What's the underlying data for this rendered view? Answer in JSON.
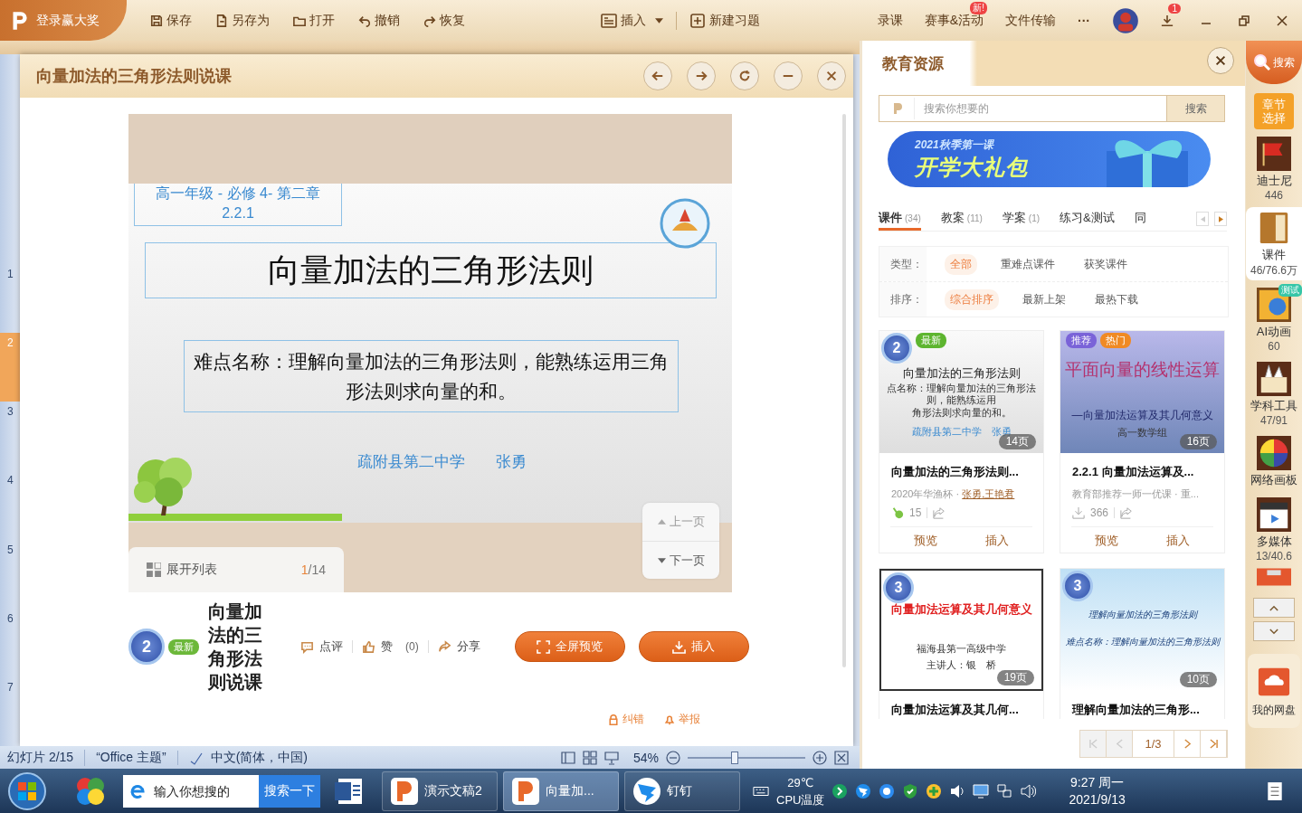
{
  "app_bar": {
    "login": "登录赢大奖",
    "tools": [
      {
        "label": "保存"
      },
      {
        "label": "另存为"
      },
      {
        "label": "打开"
      },
      {
        "label": "撤销"
      },
      {
        "label": "恢复"
      }
    ],
    "insert": "插入",
    "new_exercise": "新建习题",
    "links": [
      {
        "label": "录课"
      },
      {
        "label": "赛事&活动",
        "badge": "新!"
      },
      {
        "label": "文件传输"
      }
    ],
    "more": "···",
    "download_badge": "1"
  },
  "slide_panel": [
    {
      "number": "1",
      "selected": false
    },
    {
      "number": "2",
      "selected": true
    },
    {
      "number": "3",
      "selected": false
    },
    {
      "number": "4",
      "selected": false
    },
    {
      "number": "5",
      "selected": false
    },
    {
      "number": "6",
      "selected": false
    },
    {
      "number": "7",
      "selected": false
    }
  ],
  "dialog": {
    "title": "向量加法的三角形法则说课",
    "slide": {
      "grade": "高一年级 - 必修 4- 第二章",
      "section": "2.2.1",
      "title": "向量加法的三角形法则",
      "difficulty": "难点名称：理解向量加法的三角形法则，能熟练运用三角形法则求向量的和。",
      "school": "疏附县第二中学",
      "author": "张勇"
    },
    "list_toggle": "展开列表",
    "page_current": "1",
    "page_total": "/14",
    "prev": "上一页",
    "prev_disabled": true,
    "next": "下一页",
    "info": {
      "medal": "2",
      "tag": "最新",
      "title": "向量加法的三角形法则说课",
      "actions": [
        {
          "label": "点评"
        },
        {
          "label": "赞",
          "count": "(0)"
        },
        {
          "label": "分享"
        }
      ],
      "buttons": [
        {
          "label": "全屏预览"
        },
        {
          "label": "插入"
        }
      ]
    },
    "report_links": [
      {
        "label": "纠错"
      },
      {
        "label": "举报"
      }
    ]
  },
  "resources": {
    "title": "教育资源",
    "search": {
      "placeholder": "搜索你想要的",
      "button": "搜索"
    },
    "banner": {
      "subtitle": "2021秋季第一课",
      "title": "开学大礼包"
    },
    "tabs": [
      {
        "label": "课件",
        "count": "(34)",
        "selected": true
      },
      {
        "label": "教案",
        "count": "(11)",
        "selected": false
      },
      {
        "label": "学案",
        "count": "(1)",
        "selected": false
      },
      {
        "label": "练习&测试",
        "selected": false
      },
      {
        "label": "同",
        "selected": false
      }
    ],
    "filters": [
      {
        "label": "类型：",
        "options": [
          {
            "label": "全部",
            "selected": true
          },
          {
            "label": "重难点课件",
            "selected": false
          },
          {
            "label": "获奖课件",
            "selected": false
          }
        ]
      },
      {
        "label": "排序：",
        "options": [
          {
            "label": "综合排序",
            "selected": true
          },
          {
            "label": "最新上架",
            "selected": false
          },
          {
            "label": "最热下载",
            "selected": false
          }
        ]
      }
    ],
    "cards": [
      {
        "medal": "2",
        "tags": [
          {
            "label": "最新",
            "color": "#5db52f"
          }
        ],
        "lines": [
          {
            "text": "向量加法的三角形法则",
            "kind": "title"
          },
          {
            "text": "点名称：理解向量加法的三角形法则，能熟练运用",
            "kind": "small"
          },
          {
            "text": "角形法则求向量的和。",
            "kind": "small"
          },
          {
            "text": "疏附县第二中学　张勇",
            "kind": "note"
          }
        ],
        "pages": "14页",
        "title": "向量加法的三角形法则...",
        "source": "2020年华渔杯 · ",
        "authors": "张勇,王艳君",
        "stat": "15",
        "actions": [
          "预览",
          "插入"
        ]
      },
      {
        "tags": [
          {
            "label": "推荐",
            "color": "#7a63d8"
          },
          {
            "label": "热门",
            "color": "#f08a24"
          }
        ],
        "lines": [
          {
            "text": "平面向量的线性运算",
            "kind": "title"
          },
          {
            "text": "—向量加法运算及其几何意义",
            "kind": "subtitle"
          },
          {
            "text": "高一数学组",
            "kind": "note"
          }
        ],
        "pages": "16页",
        "title": "2.2.1 向量加法运算及...",
        "source": "教育部推荐一师一优课 · 重...",
        "stat": "366",
        "actions": [
          "预览",
          "插入"
        ]
      },
      {
        "medal": "3",
        "lines": [
          {
            "text": "向量加法运算及其几何意义",
            "kind": "title"
          },
          {
            "text": "福海县第一高级中学",
            "kind": "note"
          },
          {
            "text": "主讲人：银　桥",
            "kind": "note"
          }
        ],
        "pages": "19页",
        "title": "向量加法运算及其几何..."
      },
      {
        "medal": "3",
        "lines": [
          {
            "text": "理解向量加法的三角形法则",
            "kind": "subtitle"
          },
          {
            "text": "难点名称：理解向量加法的三角形法则",
            "kind": "subtitle"
          }
        ],
        "pages": "10页",
        "title": "理解向量加法的三角形..."
      }
    ],
    "pagination": {
      "page": "1/3",
      "first_disabled": true,
      "prev_disabled": true
    }
  },
  "sidebar": [
    {
      "kind": "search",
      "label": "搜索"
    },
    {
      "kind": "chapter",
      "label": "章节选择"
    },
    {
      "kind": "tool",
      "label": "迪士尼",
      "count": "446",
      "selected": false
    },
    {
      "kind": "tool",
      "label": "课件",
      "count": "46/76.6万",
      "selected": true
    },
    {
      "kind": "tool",
      "label": "AI动画",
      "count": "60",
      "badge": "测试",
      "selected": false
    },
    {
      "kind": "tool",
      "label": "学科工具",
      "count": "47/91",
      "selected": false
    },
    {
      "kind": "tool",
      "label": "网络画板",
      "selected": false
    },
    {
      "kind": "tool",
      "label": "多媒体",
      "count": "13/40.6",
      "selected": false
    },
    {
      "kind": "partial"
    },
    {
      "kind": "scroll"
    },
    {
      "kind": "disk",
      "label": "我的网盘"
    }
  ],
  "status_bar": {
    "slide": "幻灯片 2/15",
    "theme": "“Office 主题”",
    "language": "中文(简体，中国)",
    "zoom": {
      "text": "54%",
      "level": 0.4
    }
  },
  "taskbar": {
    "search_placeholder": "输入你想搜的",
    "search_button": "搜索一下",
    "tasks": [
      {
        "label": "演示文稿2",
        "selected": false
      },
      {
        "label": "向量加...",
        "selected": true
      },
      {
        "label": "钉钉",
        "selected": false
      }
    ],
    "temperature": "29℃",
    "cpu": "CPU温度",
    "time": "9:27 周一",
    "date": "2021/9/13"
  }
}
